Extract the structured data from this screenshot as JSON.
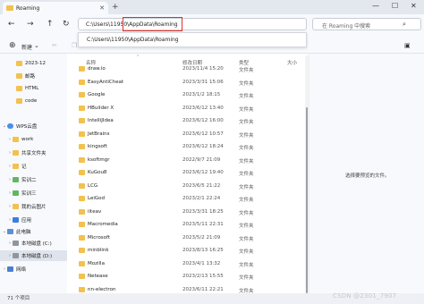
{
  "window": {
    "tab_title": "Roaming",
    "tab_close_icon": "close-icon",
    "new_tab_icon": "plus-icon",
    "buttons": [
      "minimize-icon",
      "maximize-icon",
      "close-icon"
    ]
  },
  "nav": {
    "address": "C:\\Users\\11950\\AppData\\Roaming",
    "highlighted_segment": "AppData\\Roaming",
    "search_placeholder": "在 Roaming 中搜索",
    "suggestion": "C:\\Users\\11950\\AppData\\Roaming"
  },
  "toolbar": {
    "new_label": "新建"
  },
  "sidebar": {
    "items": [
      {
        "label": "2023-12",
        "icon": "folder"
      },
      {
        "label": "邮路",
        "icon": "folder"
      },
      {
        "label": "HTML",
        "icon": "folder"
      },
      {
        "label": "code",
        "icon": "folder"
      },
      {
        "label": "WPS云盘",
        "icon": "cloud"
      },
      {
        "label": "work",
        "icon": "folder"
      },
      {
        "label": "共享文件夹",
        "icon": "folder"
      },
      {
        "label": "记",
        "icon": "folder"
      },
      {
        "label": "实训二",
        "icon": "green"
      },
      {
        "label": "实训三",
        "icon": "green"
      },
      {
        "label": "我的云图片",
        "icon": "folder"
      },
      {
        "label": "应用",
        "icon": "blue"
      },
      {
        "label": "此电脑",
        "icon": "pc"
      },
      {
        "label": "本地磁盘 (C:)",
        "icon": "disk"
      },
      {
        "label": "本地磁盘 (D:)",
        "icon": "disk"
      },
      {
        "label": "网络",
        "icon": "net"
      }
    ]
  },
  "columns": {
    "name": "名称",
    "date": "修改日期",
    "type": "类型",
    "size": "大小"
  },
  "files": [
    {
      "name": "draw.io",
      "date": "2023/11/4 15:20",
      "type": "文件夹"
    },
    {
      "name": "EasyAntiCheat",
      "date": "2023/3/31 15:06",
      "type": "文件夹"
    },
    {
      "name": "Google",
      "date": "2023/1/2 18:15",
      "type": "文件夹"
    },
    {
      "name": "HBuilder X",
      "date": "2023/6/12 13:40",
      "type": "文件夹"
    },
    {
      "name": "IntelliJIdea",
      "date": "2023/6/12 16:00",
      "type": "文件夹"
    },
    {
      "name": "JetBrains",
      "date": "2023/6/12 10:57",
      "type": "文件夹"
    },
    {
      "name": "kingsoft",
      "date": "2023/6/12 18:24",
      "type": "文件夹"
    },
    {
      "name": "ksoftmgr",
      "date": "2022/9/7 21:09",
      "type": "文件夹"
    },
    {
      "name": "KuGou8",
      "date": "2023/6/12 19:40",
      "type": "文件夹"
    },
    {
      "name": "LCG",
      "date": "2023/6/5 21:22",
      "type": "文件夹"
    },
    {
      "name": "LeiGod",
      "date": "2023/2/1 22:24",
      "type": "文件夹"
    },
    {
      "name": "iiteav",
      "date": "2023/3/31 18:25",
      "type": "文件夹"
    },
    {
      "name": "Macromedia",
      "date": "2023/5/11 22:31",
      "type": "文件夹"
    },
    {
      "name": "Microsoft",
      "date": "2023/5/2 21:09",
      "type": "文件夹"
    },
    {
      "name": "minblink",
      "date": "2023/8/13 16:25",
      "type": "文件夹"
    },
    {
      "name": "Mozilla",
      "date": "2023/4/1 13:32",
      "type": "文件夹"
    },
    {
      "name": "Netease",
      "date": "2023/2/13 15:55",
      "type": "文件夹"
    },
    {
      "name": "nn-electron",
      "date": "2023/6/11 22:21",
      "type": "文件夹"
    }
  ],
  "preview": {
    "message": "选择要预览的文件。"
  },
  "status": {
    "count": "71 个项目"
  },
  "watermark": "CSDN @2301_7907"
}
